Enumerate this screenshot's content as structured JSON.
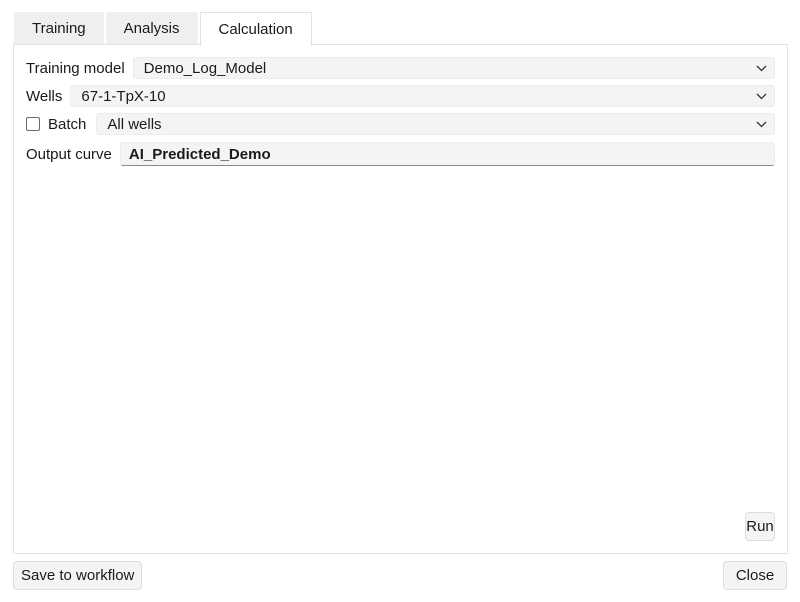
{
  "tabs": [
    {
      "label": "Training"
    },
    {
      "label": "Analysis"
    },
    {
      "label": "Calculation"
    }
  ],
  "form": {
    "training_model": {
      "label": "Training model",
      "value": "Demo_Log_Model"
    },
    "wells": {
      "label": "Wells",
      "value": "67-1-TpX-10"
    },
    "batch": {
      "label": "Batch",
      "checked": false,
      "value": "All wells"
    },
    "output_curve": {
      "label": "Output curve",
      "value": "AI_Predicted_Demo"
    }
  },
  "buttons": {
    "run": "Run",
    "save": "Save to workflow",
    "close": "Close"
  },
  "icons": {
    "dropdown": "chevron-down-icon",
    "checkbox": "checkbox-unchecked"
  }
}
